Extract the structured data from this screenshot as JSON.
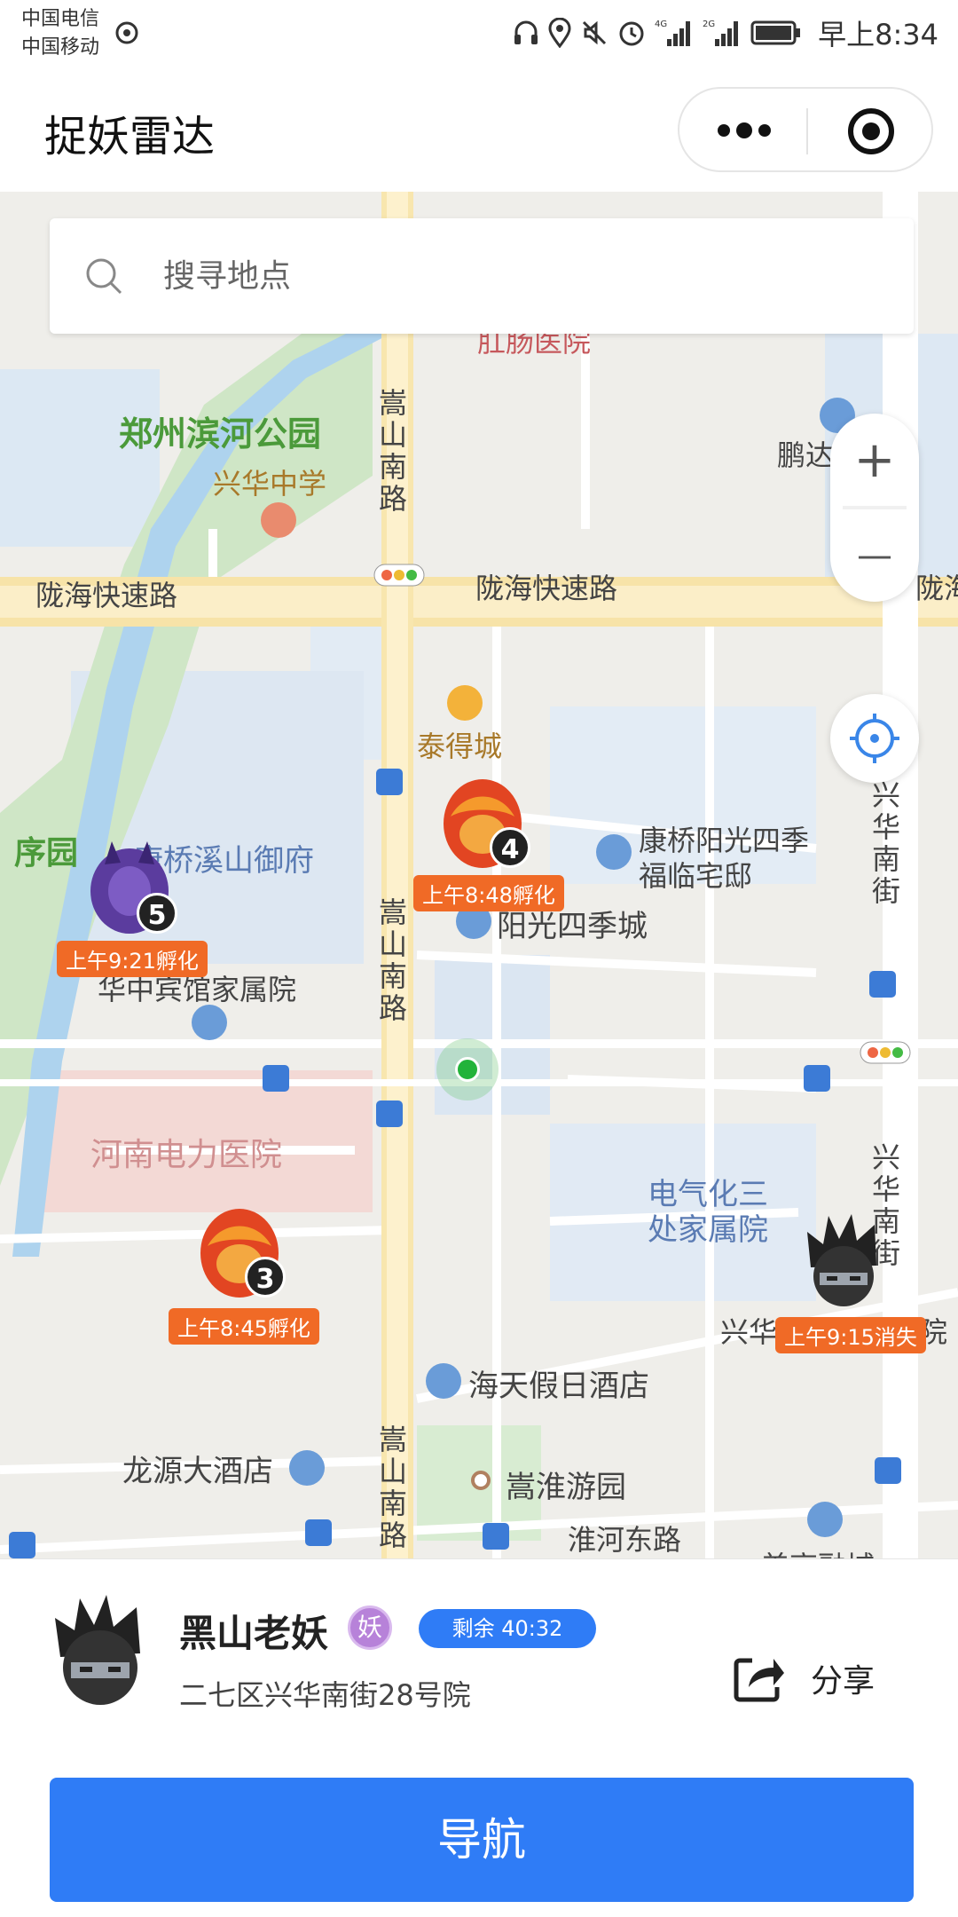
{
  "status_bar": {
    "carrier_1": "中国电信",
    "carrier_2": "中国移动",
    "network_1": "4G",
    "network_2": "2G",
    "time": "早上8:34"
  },
  "title_bar": {
    "title": "捉妖雷达"
  },
  "search": {
    "placeholder": "搜寻地点"
  },
  "zoom": {
    "in_label": "+",
    "out_label": "—"
  },
  "map_labels": {
    "park": "郑州滨河公园",
    "park_2": "序园",
    "school": "兴华中学",
    "hospital_top": "肛肠医院",
    "penghui": "鹏达",
    "expressway_1": "陇海快速路",
    "expressway_2": "陇海快速路",
    "expressway_3": "陇海",
    "songshan_1": "嵩山南路",
    "songshan_2": "嵩山南路",
    "songshan_3": "嵩山南路",
    "xinghua_1": "兴华南街",
    "xinghua_2": "兴华南街",
    "taide": "泰得城",
    "kangqiao": "康桥阳光四季",
    "fulin": "福临宅邸",
    "yangguang": "阳光四季城",
    "qiaoxi": "康桥溪山御府",
    "huazhong": "华中宾馆家属院",
    "henan_hosp": "河南电力医院",
    "dianqihua_1": "电气化三",
    "dianqihua_2": "处家属院",
    "xinghua_yard": "兴华",
    "xinghua_yard_end": "院",
    "haitian": "海天假日酒店",
    "longyuan": "龙源大酒店",
    "songhuai": "嵩淮游园",
    "huaihe": "淮河东路",
    "meigao": "美高融城"
  },
  "monsters": [
    {
      "count": "4",
      "time": "上午8:48孵化",
      "kind": "fire-egg"
    },
    {
      "count": "5",
      "time": "上午9:21孵化",
      "kind": "purple-demon"
    },
    {
      "count": "3",
      "time": "上午8:45孵化",
      "kind": "fire-egg"
    },
    {
      "count": "",
      "time": "上午9:15消失",
      "kind": "black-mountain-demon"
    }
  ],
  "panel": {
    "name": "黑山老妖",
    "badge": "妖",
    "remaining": "剩余 40:32",
    "address": "二七区兴华南街28号院",
    "share_label": "分享",
    "nav_label": "导航"
  },
  "colors": {
    "accent": "#2f7cf6",
    "timer_orange": "#f06a26",
    "badge_purple": "#b782d9",
    "user_green": "#22b33a"
  }
}
